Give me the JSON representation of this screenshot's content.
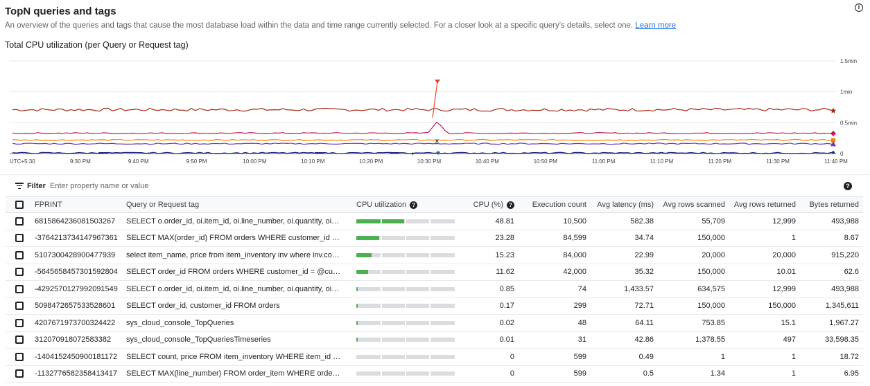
{
  "header": {
    "title": "TopN queries and tags",
    "info_icon": "info-icon",
    "description": "An overview of the queries and tags that cause the most database load within the data and time range currently selected. For a closer look at a specific query's details, select one.",
    "learn_more": "Learn more",
    "chart_title": "Total CPU utilization (per Query or Request tag)"
  },
  "chart_data": {
    "type": "line",
    "title": "Total CPU utilization (per Query or Request tag)",
    "x_tick_labels": [
      "UTC+5:30",
      "9:30 PM",
      "9:40 PM",
      "9:50 PM",
      "10:00 PM",
      "10:10 PM",
      "10:20 PM",
      "10:30 PM",
      "10:40 PM",
      "10:50 PM",
      "11:00 PM",
      "11:10 PM",
      "11:20 PM",
      "11:30 PM",
      "11:40 PM"
    ],
    "y_tick_labels": [
      "1.5min",
      "1min",
      "0.5min",
      "0"
    ],
    "ylim_min": [
      0,
      1.5
    ],
    "grid": true,
    "series": [
      {
        "color": "#a52714",
        "marker": "star",
        "baseline_min": 0.71,
        "note": "spike at 10:32 PM"
      },
      {
        "color": "#c2185b",
        "marker": "diamond",
        "baseline_min": 0.33,
        "peak_min": 0.52
      },
      {
        "color": "#f57c00",
        "marker": "square",
        "baseline_min": 0.22
      },
      {
        "color": "#673ab7",
        "marker": "triangle",
        "baseline_min": 0.16
      },
      {
        "color": "#1a237e",
        "marker": "cross",
        "baseline_min": 0.01
      }
    ]
  },
  "filter": {
    "label": "Filter",
    "placeholder": "Enter property name or value"
  },
  "table": {
    "columns": {
      "fprint": "FPRINT",
      "query": "Query or Request tag",
      "cpu_util": "CPU utilization",
      "cpu_pct": "CPU (%)",
      "exec_count": "Execution count",
      "avg_latency": "Avg latency (ms)",
      "avg_rows_scanned": "Avg rows scanned",
      "avg_rows_returned": "Avg rows returned",
      "bytes_returned": "Bytes returned"
    },
    "rows": [
      {
        "fprint": "6815864236081503267",
        "query": "SELECT o.order_id, oi.item_id, oi.line_number, oi.quantity, oi.price, ...",
        "cpu_fraction": 0.4881,
        "cpu_pct": "48.81",
        "exec_count": "10,500",
        "avg_latency": "582.38",
        "avg_rows_scanned": "55,709",
        "avg_rows_returned": "12,999",
        "bytes_returned": "493,988"
      },
      {
        "fprint": "-3764213734147967361",
        "query": "SELECT MAX(order_id) FROM orders WHERE customer_id = @cid",
        "cpu_fraction": 0.2328,
        "cpu_pct": "23.28",
        "exec_count": "84,599",
        "avg_latency": "34.74",
        "avg_rows_scanned": "150,000",
        "avg_rows_returned": "1",
        "bytes_returned": "8.67"
      },
      {
        "fprint": "5107300428900477939",
        "query": "select item_name, price from item_inventory inv where inv.count >...",
        "cpu_fraction": 0.1523,
        "cpu_pct": "15.23",
        "exec_count": "84,000",
        "avg_latency": "22.99",
        "avg_rows_scanned": "20,000",
        "avg_rows_returned": "20,000",
        "bytes_returned": "915,220"
      },
      {
        "fprint": "-5645658457301592804",
        "query": "SELECT order_id FROM orders WHERE customer_id = @custId",
        "cpu_fraction": 0.1162,
        "cpu_pct": "11.62",
        "exec_count": "42,000",
        "avg_latency": "35.32",
        "avg_rows_scanned": "150,000",
        "avg_rows_returned": "10.01",
        "bytes_returned": "62.6"
      },
      {
        "fprint": "-4292570127992091549",
        "query": "SELECT o.order_id, oi.item_id, oi.line_number, oi.quantity, oi.price, ...",
        "cpu_fraction": 0.0085,
        "cpu_pct": "0.85",
        "exec_count": "74",
        "avg_latency": "1,433.57",
        "avg_rows_scanned": "634,575",
        "avg_rows_returned": "12,999",
        "bytes_returned": "493,988"
      },
      {
        "fprint": "5098472657533528601",
        "query": "SELECT order_id, customer_id FROM orders",
        "cpu_fraction": 0.0017,
        "cpu_pct": "0.17",
        "exec_count": "299",
        "avg_latency": "72.71",
        "avg_rows_scanned": "150,000",
        "avg_rows_returned": "150,000",
        "bytes_returned": "1,345,611"
      },
      {
        "fprint": "4207671973700324422",
        "query": "sys_cloud_console_TopQueries",
        "cpu_fraction": 0.0002,
        "cpu_pct": "0.02",
        "exec_count": "48",
        "avg_latency": "64.11",
        "avg_rows_scanned": "753.85",
        "avg_rows_returned": "15.1",
        "bytes_returned": "1,967.27"
      },
      {
        "fprint": "312070918072583382",
        "query": "sys_cloud_console_TopQueriesTimeseries",
        "cpu_fraction": 0.0001,
        "cpu_pct": "0.01",
        "exec_count": "31",
        "avg_latency": "42.86",
        "avg_rows_scanned": "1,378.55",
        "avg_rows_returned": "497",
        "bytes_returned": "33,598.35"
      },
      {
        "fprint": "-1404152450900181172",
        "query": "SELECT count, price FROM item_inventory WHERE item_id = @id",
        "cpu_fraction": 0,
        "cpu_pct": "0",
        "exec_count": "599",
        "avg_latency": "0.49",
        "avg_rows_scanned": "1",
        "avg_rows_returned": "1",
        "bytes_returned": "18.72"
      },
      {
        "fprint": "-1132776582358413417",
        "query": "SELECT MAX(line_number) FROM order_item WHERE order_id = ...",
        "cpu_fraction": 0,
        "cpu_pct": "0",
        "exec_count": "599",
        "avg_latency": "0.5",
        "avg_rows_scanned": "1.34",
        "avg_rows_returned": "1",
        "bytes_returned": "6.95"
      }
    ]
  }
}
